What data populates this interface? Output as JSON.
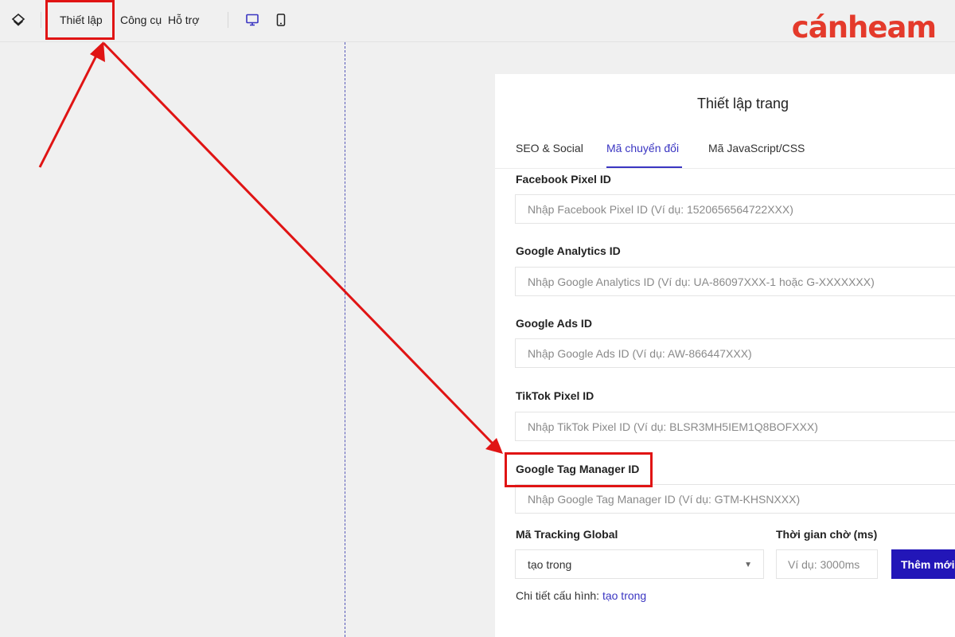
{
  "topbar": {
    "layers_icon": "layers-icon",
    "menu": [
      "Thiết lập",
      "Công cụ",
      "Hỗ trợ"
    ],
    "desktop_icon": "desktop-icon",
    "mobile_icon": "mobile-icon",
    "accent": "#3a35c2"
  },
  "logo": {
    "text": "cánheam",
    "color": "#e43a2b"
  },
  "panel": {
    "title": "Thiết lập trang",
    "tabs": [
      "SEO & Social",
      "Mã chuyển đổi",
      "Mã JavaScript/CSS"
    ],
    "active_tab": "Mã chuyển đổi",
    "fields": [
      {
        "label": "Facebook Pixel ID",
        "placeholder": "Nhập Facebook Pixel ID (Ví dụ: 1520656564722XXX)"
      },
      {
        "label": "Google Analytics ID",
        "placeholder": "Nhập Google Analytics ID (Ví dụ: UA-86097XXX-1 hoặc G-XXXXXXX)"
      },
      {
        "label": "Google Ads ID",
        "placeholder": "Nhập Google Ads ID (Ví dụ: AW-866447XXX)"
      },
      {
        "label": "TikTok Pixel ID",
        "placeholder": "Nhập TikTok Pixel ID (Ví dụ: BLSR3MH5IEM1Q8BOFXXX)"
      },
      {
        "label": "Google Tag Manager ID",
        "placeholder": "Nhập Google Tag Manager ID (Ví dụ: GTM-KHSNXXX)"
      }
    ],
    "tracking": {
      "label": "Mã Tracking Global",
      "selected": "tạo trong",
      "caret": "▼",
      "delay_label": "Thời gian chờ (ms)",
      "delay_placeholder": "Ví dụ: 3000ms",
      "add_button": "Thêm mới",
      "config_prefix": "Chi tiết cấu hình:",
      "config_link": "tạo trong"
    }
  },
  "annotation_color": "#e01414"
}
